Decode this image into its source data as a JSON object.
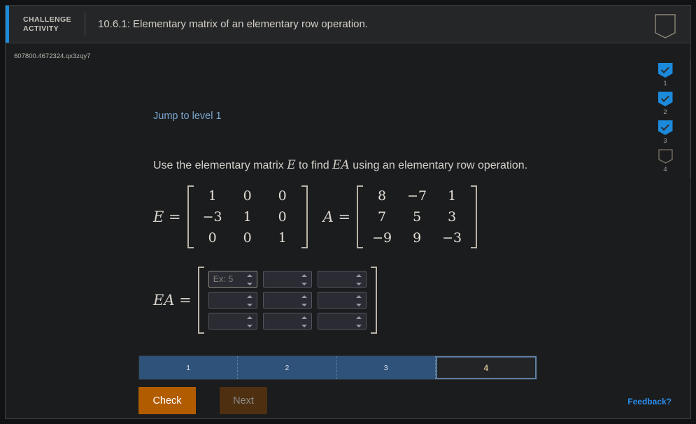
{
  "header": {
    "kicker_line1": "CHALLENGE",
    "kicker_line2": "ACTIVITY",
    "title": "10.6.1: Elementary matrix of an elementary row operation.",
    "bookmark_icon": "bookmark-icon",
    "accent_color": "#1c8adb"
  },
  "question_id": "607800.4672324.qx3zqy7",
  "jump_link": "Jump to level 1",
  "prompt": {
    "part1": "Use the elementary matrix ",
    "var1": "E",
    "part2": " to find ",
    "var2": "EA",
    "part3": " using an elementary row operation."
  },
  "matrices": {
    "E": {
      "label": "E =",
      "rows": [
        [
          "1",
          "0",
          "0"
        ],
        [
          "−3",
          "1",
          "0"
        ],
        [
          "0",
          "0",
          "1"
        ]
      ]
    },
    "A": {
      "label": "A =",
      "rows": [
        [
          "8",
          "−7",
          "1"
        ],
        [
          "7",
          "5",
          "3"
        ],
        [
          "−9",
          "9",
          "−3"
        ]
      ]
    },
    "EA": {
      "label": "EA =",
      "cells": [
        {
          "value": "",
          "placeholder": "Ex: 5",
          "focused": true
        },
        {
          "value": "",
          "placeholder": "",
          "focused": false
        },
        {
          "value": "",
          "placeholder": "",
          "focused": false
        },
        {
          "value": "",
          "placeholder": "",
          "focused": false
        },
        {
          "value": "",
          "placeholder": "",
          "focused": false
        },
        {
          "value": "",
          "placeholder": "",
          "focused": false
        },
        {
          "value": "",
          "placeholder": "",
          "focused": false
        },
        {
          "value": "",
          "placeholder": "",
          "focused": false
        },
        {
          "value": "",
          "placeholder": "",
          "focused": false
        }
      ]
    }
  },
  "level_rail": [
    {
      "label": "1",
      "state": "complete"
    },
    {
      "label": "2",
      "state": "complete"
    },
    {
      "label": "3",
      "state": "complete"
    },
    {
      "label": "4",
      "state": "pending"
    }
  ],
  "progress": {
    "segments": [
      {
        "label": "1",
        "state": "complete"
      },
      {
        "label": "2",
        "state": "complete"
      },
      {
        "label": "3",
        "state": "complete"
      },
      {
        "label": "4",
        "state": "current"
      }
    ],
    "fill_color": "#2e5279",
    "current_border": "#5c7da0"
  },
  "buttons": {
    "check": "Check",
    "next": "Next",
    "check_color": "#b25c00",
    "next_color": "#4e3011"
  },
  "feedback_link": "Feedback?"
}
